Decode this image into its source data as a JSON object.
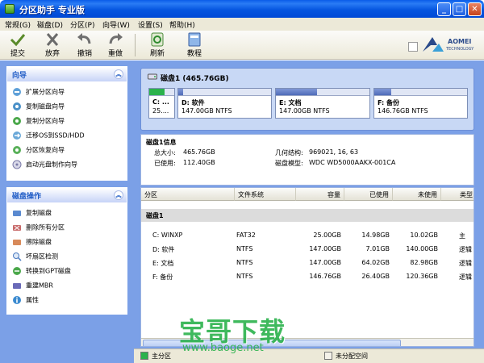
{
  "window": {
    "title": "分区助手 专业版",
    "minimize_glyph": "_",
    "maximize_glyph": "□",
    "close_glyph": "✕"
  },
  "menu": [
    "常规(G)",
    "磁盘(D)",
    "分区(P)",
    "向导(W)",
    "设置(S)",
    "帮助(H)"
  ],
  "toolbar": {
    "submit": "提交",
    "discard": "放弃",
    "undo": "撤销",
    "redo": "重做",
    "refresh": "刷新",
    "tutorial": "教程",
    "brand_name": "AOMEI",
    "brand_sub": "TECHNOLOGY"
  },
  "wizard_panel": {
    "title": "向导",
    "collapse_glyph": "︽",
    "items": [
      "扩展分区向导",
      "复制磁盘向导",
      "复制分区向导",
      "迁移OS到SSD/HDD",
      "分区恢复向导",
      "启动光盘制作向导"
    ]
  },
  "disk_ops_panel": {
    "title": "磁盘操作",
    "collapse_glyph": "︽",
    "items": [
      "复制磁盘",
      "删除所有分区",
      "擦除磁盘",
      "坏扇区检测",
      "转换到GPT磁盘",
      "重建MBR",
      "属性"
    ]
  },
  "disk_map": {
    "title": "磁盘1 (465.76GB)",
    "partitions": [
      {
        "name": "C: ...",
        "size": "25....",
        "used_fraction": 0.6,
        "color": "#2bb24c"
      },
      {
        "name": "D: 软件",
        "size": "147.00GB NTFS",
        "used_fraction": 0.05
      },
      {
        "name": "E: 文档",
        "size": "147.00GB NTFS",
        "used_fraction": 0.44
      },
      {
        "name": "F: 备份",
        "size": "146.76GB NTFS",
        "used_fraction": 0.18
      }
    ]
  },
  "disk_info": {
    "title": "磁盘1信息",
    "total_label": "总大小:",
    "total_value": "465.76GB",
    "used_label": "已使用:",
    "used_value": "112.40GB",
    "geometry_label": "几何结构:",
    "geometry_value": "969021, 16, 63",
    "model_label": "磁盘模型:",
    "model_value": "WDC WD5000AAKX-001CA"
  },
  "table": {
    "headers": [
      "分区",
      "文件系统",
      "容量",
      "已使用",
      "未使用",
      "类型"
    ],
    "group": "磁盘1",
    "rows": [
      [
        "C: WINXP",
        "FAT32",
        "25.00GB",
        "14.98GB",
        "10.02GB",
        "主"
      ],
      [
        "D: 软件",
        "NTFS",
        "147.00GB",
        "7.01GB",
        "140.00GB",
        "逻辑"
      ],
      [
        "E: 文档",
        "NTFS",
        "147.00GB",
        "64.02GB",
        "82.98GB",
        "逻辑"
      ],
      [
        "F: 备份",
        "NTFS",
        "146.76GB",
        "26.40GB",
        "120.36GB",
        "逻辑"
      ]
    ]
  },
  "status": {
    "primary_label": "主分区",
    "primary_color": "#2bb24c",
    "unalloc_label": "未分配空间"
  },
  "watermark": {
    "main": "宝哥下载",
    "url": "www.baoge.net"
  }
}
